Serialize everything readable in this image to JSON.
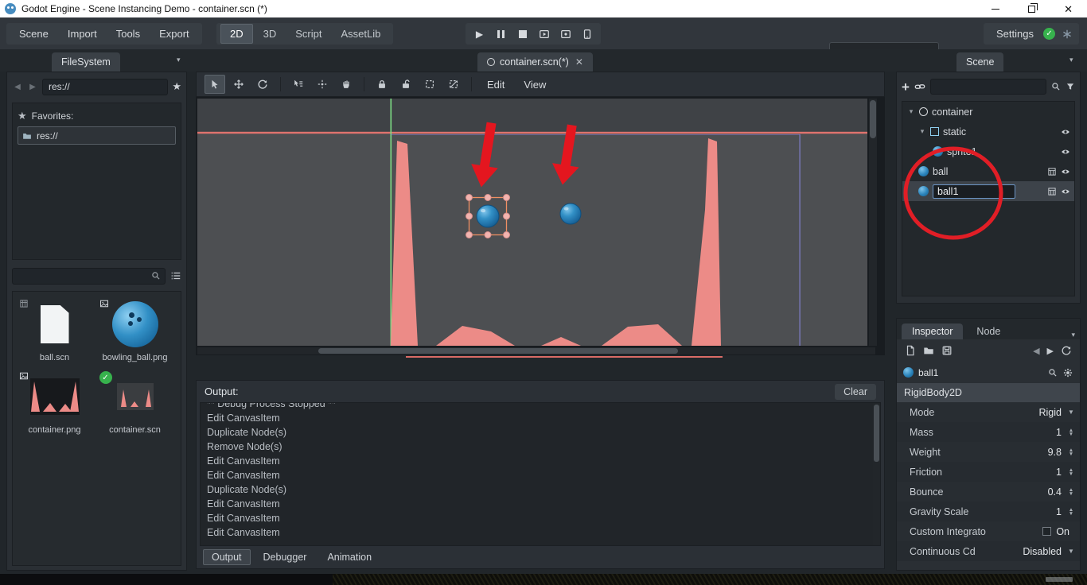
{
  "titlebar": {
    "title": "Godot Engine - Scene Instancing Demo - container.scn (*)"
  },
  "menubar": {
    "items": [
      "Scene",
      "Import",
      "Tools",
      "Export"
    ]
  },
  "workspace": {
    "tabs": [
      "2D",
      "3D",
      "Script",
      "AssetLib"
    ]
  },
  "settings": {
    "label": "Settings"
  },
  "tabs": {
    "filesystem": "FileSystem",
    "scene_file": "container.scn(*)",
    "scene_panel": "Scene"
  },
  "filesystem": {
    "path": "res://",
    "favorites_label": "Favorites:",
    "favorite_path": "res://",
    "files": [
      {
        "name": "ball.scn"
      },
      {
        "name": "bowling_ball.png"
      },
      {
        "name": "container.png"
      },
      {
        "name": "container.scn"
      }
    ]
  },
  "canvas_toolbar": {
    "edit": "Edit",
    "view": "View"
  },
  "output": {
    "title": "Output:",
    "clear_label": "Clear",
    "lines": [
      "** Debug Process Stopped **",
      "Edit CanvasItem",
      "Duplicate Node(s)",
      "Remove Node(s)",
      "Edit CanvasItem",
      "Edit CanvasItem",
      "Duplicate Node(s)",
      "Edit CanvasItem",
      "Edit CanvasItem",
      "Edit CanvasItem"
    ],
    "tabs": [
      "Output",
      "Debugger",
      "Animation"
    ]
  },
  "scene_tree": {
    "nodes": [
      {
        "name": "container"
      },
      {
        "name": "static"
      },
      {
        "name": "sprite1"
      },
      {
        "name": "ball"
      },
      {
        "name": "ball1"
      }
    ]
  },
  "inspector": {
    "tab_inspector": "Inspector",
    "tab_node": "Node",
    "object_name": "ball1",
    "class_name": "RigidBody2D",
    "properties": [
      {
        "name": "Mode",
        "value": "Rigid"
      },
      {
        "name": "Mass",
        "value": "1"
      },
      {
        "name": "Weight",
        "value": "9.8"
      },
      {
        "name": "Friction",
        "value": "1"
      },
      {
        "name": "Bounce",
        "value": "0.4"
      },
      {
        "name": "Gravity Scale",
        "value": "1"
      },
      {
        "name": "Custom Integrato",
        "value": "On"
      },
      {
        "name": "Continuous Cd",
        "value": "Disabled"
      }
    ]
  },
  "colors": {
    "accent_red": "#e11e26",
    "salmon": "#ec8b87",
    "ball_blue": "#2b84bb",
    "ok_green": "#37b24d"
  }
}
